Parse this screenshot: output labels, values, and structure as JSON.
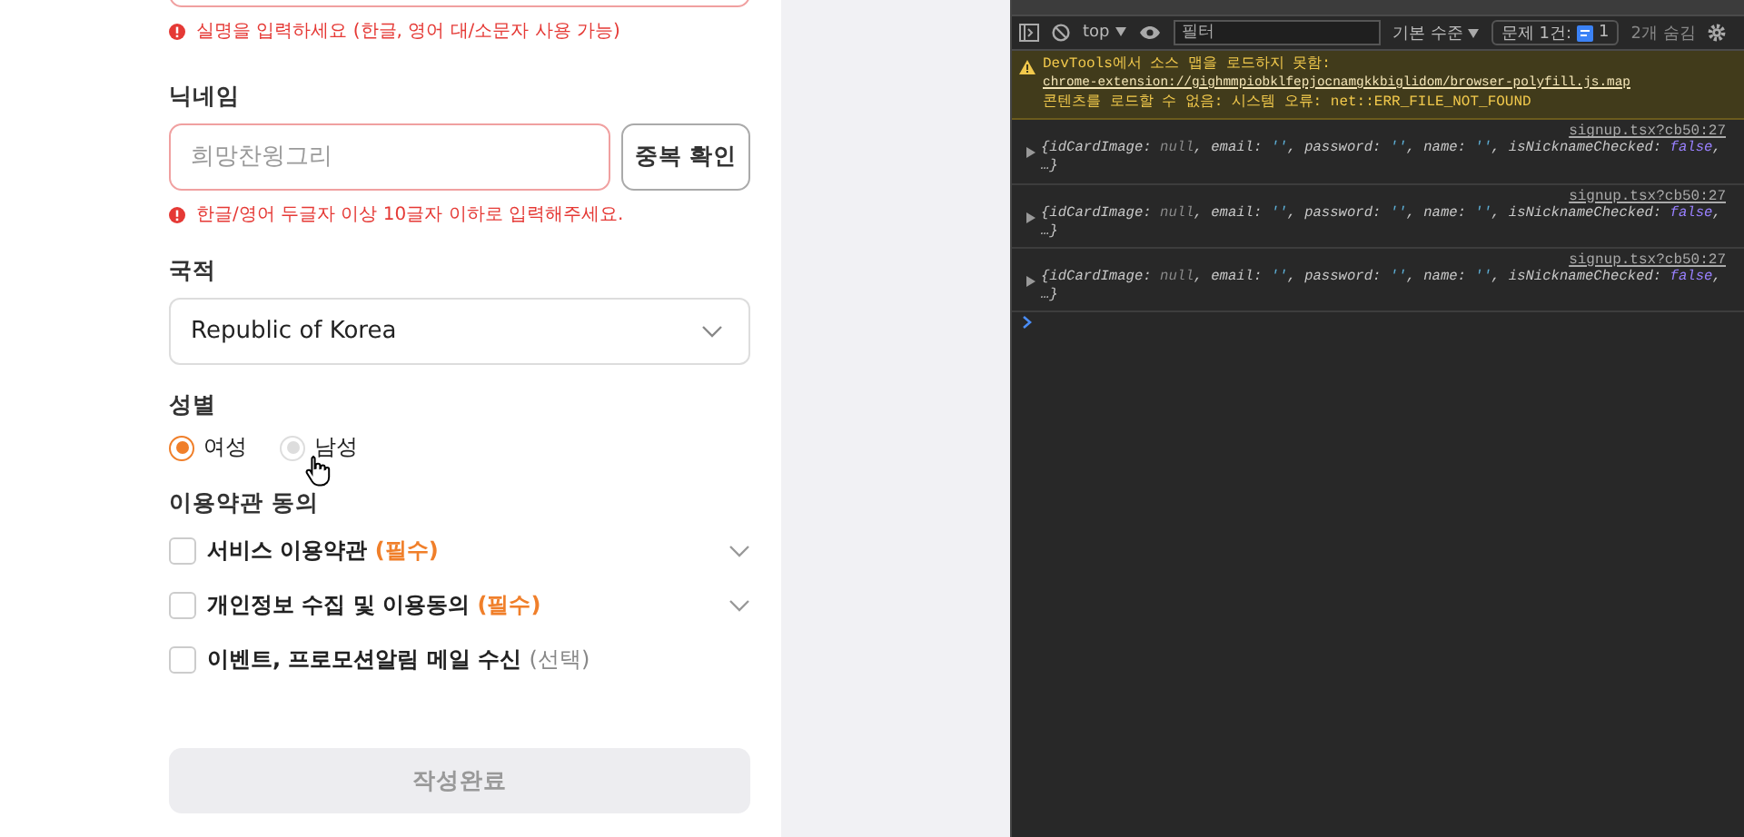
{
  "form": {
    "name_error": "실명을 입력하세요 (한글, 영어 대/소문자 사용 가능)",
    "nickname": {
      "label": "닉네임",
      "placeholder": "희망찬윙그리",
      "button": "중복 확인",
      "error": "한글/영어 두글자 이상 10글자 이하로 입력해주세요."
    },
    "nationality": {
      "label": "국적",
      "value": "Republic of Korea"
    },
    "gender": {
      "label": "성별",
      "options": [
        {
          "label": "여성",
          "selected": true
        },
        {
          "label": "남성",
          "selected": false
        }
      ]
    },
    "terms": {
      "label": "이용약관 동의",
      "items": [
        {
          "label": "서비스 이용약관",
          "tag": "(필수)",
          "required": true,
          "checked": false,
          "expandable": true
        },
        {
          "label": "개인정보 수집 및 이용동의",
          "tag": "(필수)",
          "required": true,
          "checked": false,
          "expandable": true
        },
        {
          "label": "이벤트, 프로모션알림 메일 수신",
          "tag": "(선택)",
          "required": false,
          "checked": false,
          "expandable": false
        }
      ]
    },
    "submit": {
      "label": "작성완료",
      "disabled": true
    }
  },
  "devtools": {
    "toolbar": {
      "context": "top",
      "filter_placeholder": "필터",
      "level": "기본 수준",
      "issues_label": "문제 1건:",
      "issues_count": "1",
      "hidden": "2개 숨김"
    },
    "warning": {
      "text": "DevTools에서 소스 맵을 로드하지 못함: ",
      "link": "chrome-extension://gighmmpiobklfepjocnamgkkbiglidom/browser-polyfill.js.map",
      "rest": " 콘텐츠를 로드할 수 없음: 시스템 오류: net::ERR_FILE_NOT_FOUND"
    },
    "logs": [
      {
        "source": "signup.tsx?cb50:27",
        "tokens": [
          {
            "kind": "key",
            "text": "{idCardImage: "
          },
          {
            "kind": "null",
            "text": "null"
          },
          {
            "kind": "key",
            "text": ", email: "
          },
          {
            "kind": "string",
            "text": "''"
          },
          {
            "kind": "key",
            "text": ", password: "
          },
          {
            "kind": "string",
            "text": "''"
          },
          {
            "kind": "key",
            "text": ", name: "
          },
          {
            "kind": "string",
            "text": "''"
          },
          {
            "kind": "key",
            "text": ", isNicknameChecked: "
          },
          {
            "kind": "bool",
            "text": "false"
          },
          {
            "kind": "key",
            "text": ", …}"
          }
        ]
      },
      {
        "source": "signup.tsx?cb50:27",
        "tokens": [
          {
            "kind": "key",
            "text": "{idCardImage: "
          },
          {
            "kind": "null",
            "text": "null"
          },
          {
            "kind": "key",
            "text": ", email: "
          },
          {
            "kind": "string",
            "text": "''"
          },
          {
            "kind": "key",
            "text": ", password: "
          },
          {
            "kind": "string",
            "text": "''"
          },
          {
            "kind": "key",
            "text": ", name: "
          },
          {
            "kind": "string",
            "text": "''"
          },
          {
            "kind": "key",
            "text": ", isNicknameChecked: "
          },
          {
            "kind": "bool",
            "text": "false"
          },
          {
            "kind": "key",
            "text": ", …}"
          }
        ]
      },
      {
        "source": "signup.tsx?cb50:27",
        "tokens": [
          {
            "kind": "key",
            "text": "{idCardImage: "
          },
          {
            "kind": "null",
            "text": "null"
          },
          {
            "kind": "key",
            "text": ", email: "
          },
          {
            "kind": "string",
            "text": "''"
          },
          {
            "kind": "key",
            "text": ", password: "
          },
          {
            "kind": "string",
            "text": "''"
          },
          {
            "kind": "key",
            "text": ", name: "
          },
          {
            "kind": "string",
            "text": "''"
          },
          {
            "kind": "key",
            "text": ", isNicknameChecked: "
          },
          {
            "kind": "bool",
            "text": "false"
          },
          {
            "kind": "key",
            "text": ", …}"
          }
        ]
      }
    ]
  }
}
